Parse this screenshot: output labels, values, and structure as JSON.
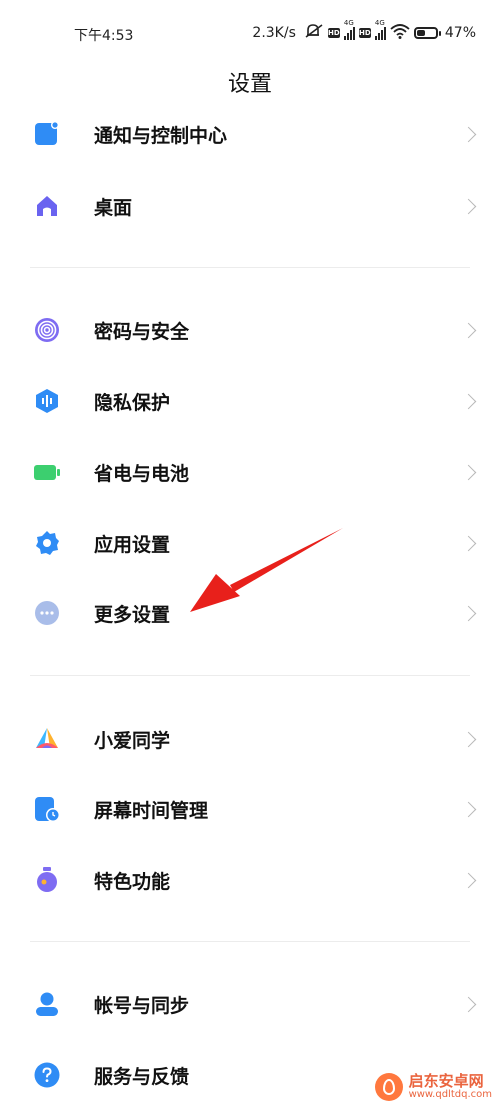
{
  "status_bar": {
    "time": "下午4:53",
    "speed": "2.3K/s",
    "hd1": "HD",
    "net1": "4G",
    "hd2": "HD",
    "net2": "4G",
    "battery_percent": "47%",
    "battery_level": 0.47
  },
  "page": {
    "title": "设置"
  },
  "groups": [
    {
      "items": [
        {
          "label": "通知与控制中心",
          "icon": "notification-icon",
          "color": "#2f8cf5"
        },
        {
          "label": "桌面",
          "icon": "home-icon",
          "color": "#6a63f0"
        }
      ]
    },
    {
      "items": [
        {
          "label": "密码与安全",
          "icon": "fingerprint-icon",
          "color": "#7e6cf2"
        },
        {
          "label": "隐私保护",
          "icon": "privacy-icon",
          "color": "#2f8cf5"
        },
        {
          "label": "省电与电池",
          "icon": "battery-icon",
          "color": "#3ccf6f"
        },
        {
          "label": "应用设置",
          "icon": "gear-icon",
          "color": "#2f8cf5"
        },
        {
          "label": "更多设置",
          "icon": "more-icon",
          "color": "#9db3e8"
        }
      ]
    },
    {
      "items": [
        {
          "label": "小爱同学",
          "icon": "xiaoai-icon",
          "color": "#ff5a6a"
        },
        {
          "label": "屏幕时间管理",
          "icon": "screen-time-icon",
          "color": "#2f8cf5"
        },
        {
          "label": "特色功能",
          "icon": "features-icon",
          "color": "#7e6cf2"
        }
      ]
    },
    {
      "items": [
        {
          "label": "帐号与同步",
          "icon": "account-icon",
          "color": "#2f8cf5"
        },
        {
          "label": "服务与反馈",
          "icon": "help-icon",
          "color": "#2f8cf5"
        }
      ]
    }
  ],
  "watermark": {
    "name": "启东安卓网",
    "url": "www.qdltdq.com"
  }
}
